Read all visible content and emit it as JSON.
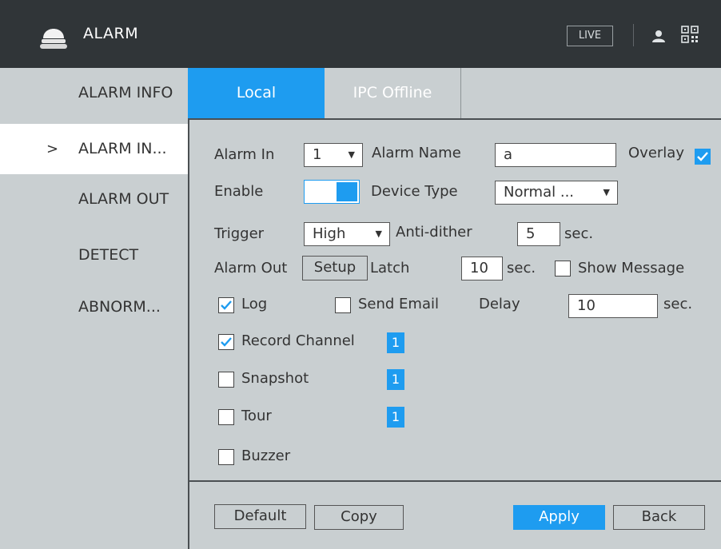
{
  "titlebar": {
    "title": "ALARM",
    "live_label": "LIVE"
  },
  "sidebar": {
    "items": [
      {
        "label": "ALARM INFO",
        "active": false
      },
      {
        "label": "ALARM IN...",
        "active": true
      },
      {
        "label": "ALARM OUT",
        "active": false
      },
      {
        "label": "DETECT",
        "active": false
      },
      {
        "label": "ABNORM...",
        "active": false
      }
    ],
    "active_marker": ">"
  },
  "tabs": [
    {
      "label": "Local",
      "active": true
    },
    {
      "label": "IPC Offline",
      "active": false
    }
  ],
  "form": {
    "alarm_in_label": "Alarm In",
    "alarm_in_value": "1",
    "alarm_name_label": "Alarm Name",
    "alarm_name_value": "a",
    "overlay_label": "Overlay",
    "overlay_checked": true,
    "enable_label": "Enable",
    "enable_on": true,
    "device_type_label": "Device Type",
    "device_type_value": "Normal ...",
    "trigger_label": "Trigger",
    "trigger_value": "High",
    "anti_dither_label": "Anti-dither",
    "anti_dither_value": "5",
    "anti_dither_unit": "sec.",
    "alarm_out_label": "Alarm Out",
    "setup_label": "Setup",
    "latch_label": "Latch",
    "latch_value": "10",
    "latch_unit": "sec.",
    "show_message_label": "Show Message",
    "show_message_checked": false,
    "log_label": "Log",
    "log_checked": true,
    "send_email_label": "Send Email",
    "send_email_checked": false,
    "delay_label": "Delay",
    "delay_value": "10",
    "delay_unit": "sec.",
    "record_channel_label": "Record Channel",
    "record_channel_checked": true,
    "record_channel_badge": "1",
    "snapshot_label": "Snapshot",
    "snapshot_checked": false,
    "snapshot_badge": "1",
    "tour_label": "Tour",
    "tour_checked": false,
    "tour_badge": "1",
    "buzzer_label": "Buzzer",
    "buzzer_checked": false
  },
  "footer": {
    "default_label": "Default",
    "copy_label": "Copy",
    "apply_label": "Apply",
    "back_label": "Back"
  },
  "colors": {
    "accent": "#1e9cf0",
    "titlebar_bg": "#303538",
    "panel_bg": "#c9cfd1"
  }
}
